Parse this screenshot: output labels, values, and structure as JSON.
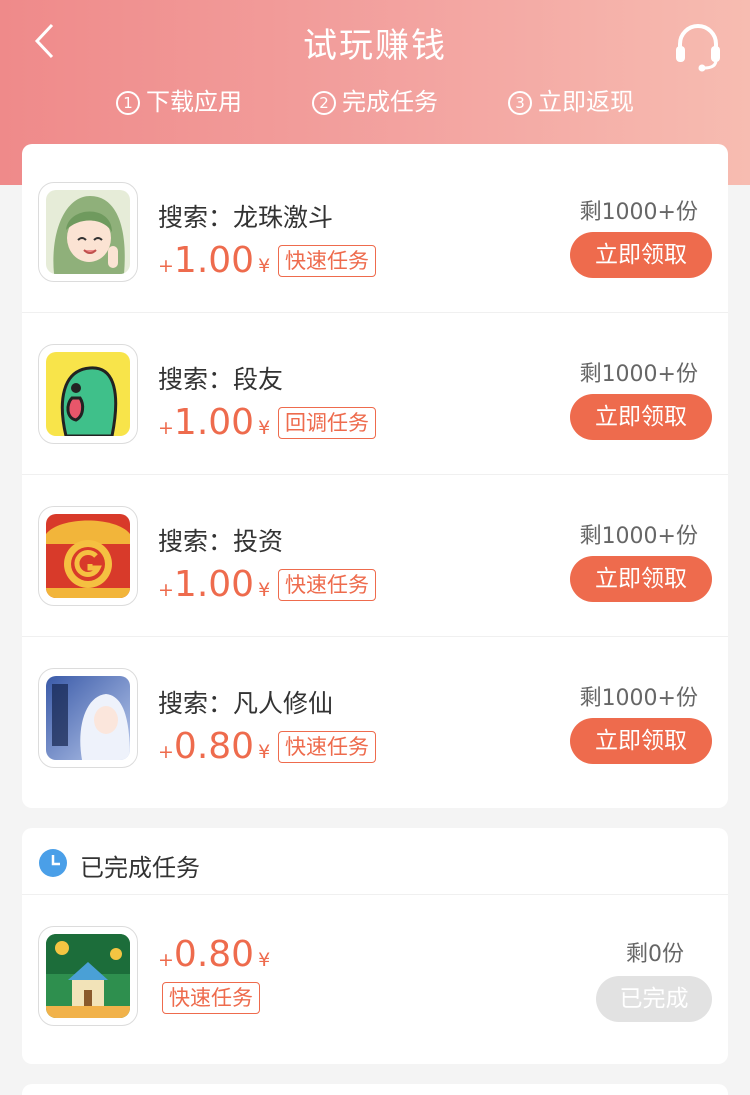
{
  "header": {
    "title": "试玩赚钱",
    "steps": [
      {
        "num": "1",
        "label": "下载应用"
      },
      {
        "num": "2",
        "label": "完成任务"
      },
      {
        "num": "3",
        "label": "立即返现"
      }
    ]
  },
  "tasks": [
    {
      "name": "搜索：龙珠激斗",
      "plus": "+",
      "amount": "1.00",
      "yen": "¥",
      "tag": "快速任务",
      "remain": "剩1000+份",
      "button": "立即领取"
    },
    {
      "name": "搜索：段友",
      "plus": "+",
      "amount": "1.00",
      "yen": "¥",
      "tag": "回调任务",
      "remain": "剩1000+份",
      "button": "立即领取"
    },
    {
      "name": "搜索：投资",
      "plus": "+",
      "amount": "1.00",
      "yen": "¥",
      "tag": "快速任务",
      "remain": "剩1000+份",
      "button": "立即领取"
    },
    {
      "name": "搜索：凡人修仙",
      "plus": "+",
      "amount": "0.80",
      "yen": "¥",
      "tag": "快速任务",
      "remain": "剩1000+份",
      "button": "立即领取"
    }
  ],
  "completed": {
    "title": "已完成任务",
    "items": [
      {
        "plus": "+",
        "amount": "0.80",
        "yen": "¥",
        "tag": "快速任务",
        "remain": "剩0份",
        "button": "已完成"
      }
    ]
  },
  "colors": {
    "accent": "#ee6b4d",
    "header_start": "#ef8a8a",
    "header_end": "#f7bcb1",
    "done_button": "#e2e2e2",
    "clock": "#4a9fe8"
  },
  "icons": [
    "back-arrow-icon",
    "headset-icon",
    "clock-icon"
  ]
}
